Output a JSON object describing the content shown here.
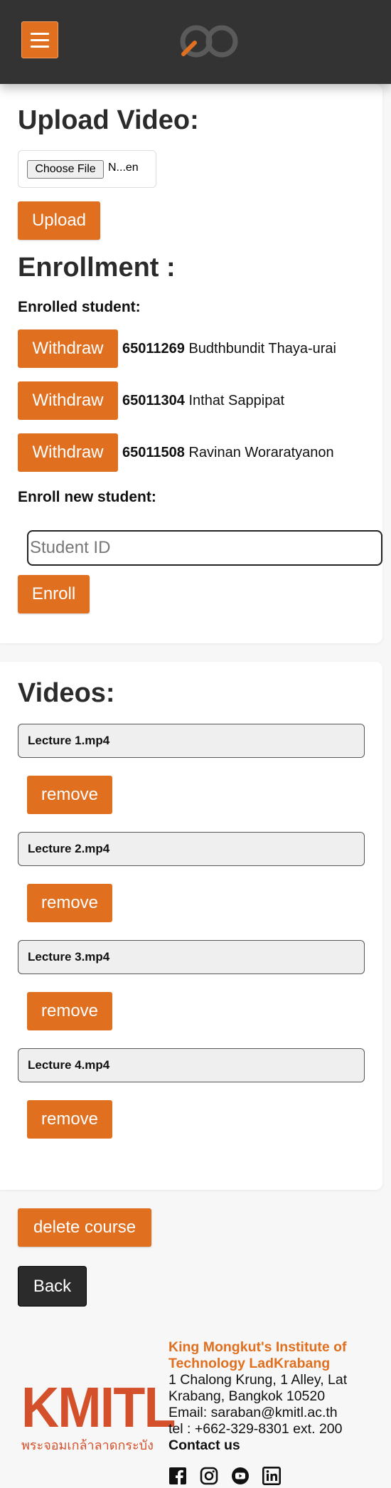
{
  "header": {
    "menu_icon": "hamburger-menu-icon",
    "logo_icon": "infinity-logo-icon"
  },
  "upload": {
    "heading": "Upload Video:",
    "choose_file_label": "Choose File",
    "file_name": "N...en",
    "upload_label": "Upload"
  },
  "enrollment": {
    "heading": "Enrollment :",
    "enrolled_label": "Enrolled student:",
    "students": [
      {
        "id": "65011269",
        "name": "Budthbundit Thaya-urai",
        "withdraw_label": "Withdraw"
      },
      {
        "id": "65011304",
        "name": "Inthat Sappipat",
        "withdraw_label": "Withdraw"
      },
      {
        "id": "65011508",
        "name": "Ravinan Woraratyanon",
        "withdraw_label": "Withdraw"
      }
    ],
    "new_label": "Enroll new student:",
    "student_id_placeholder": "Student ID",
    "enroll_label": "Enroll"
  },
  "videos": {
    "heading": "Videos:",
    "items": [
      {
        "name": "Lecture 1.mp4",
        "remove_label": "remove"
      },
      {
        "name": "Lecture 2.mp4",
        "remove_label": "remove"
      },
      {
        "name": "Lecture 3.mp4",
        "remove_label": "remove"
      },
      {
        "name": "Lecture 4.mp4",
        "remove_label": "remove"
      }
    ]
  },
  "actions": {
    "delete_label": "delete course",
    "back_label": "Back"
  },
  "footer": {
    "logo_text": "KMITL",
    "logo_thai": "พระจอมเกล้าลาดกระบัง",
    "university": "King Mongkut's Institute of Technology LadKrabang",
    "address": "1 Chalong Krung, 1 Alley, Lat Krabang, Bangkok 10520",
    "email": "Email: saraban@kmitl.ac.th",
    "tel": "tel : +662-329-8301 ext. 200",
    "contact": "Contact us",
    "socials": [
      "facebook-icon",
      "instagram-icon",
      "youtube-icon",
      "linkedin-icon"
    ]
  },
  "colors": {
    "accent": "#e07020",
    "header_bg": "#333333",
    "footer_brand": "#d4502a"
  }
}
